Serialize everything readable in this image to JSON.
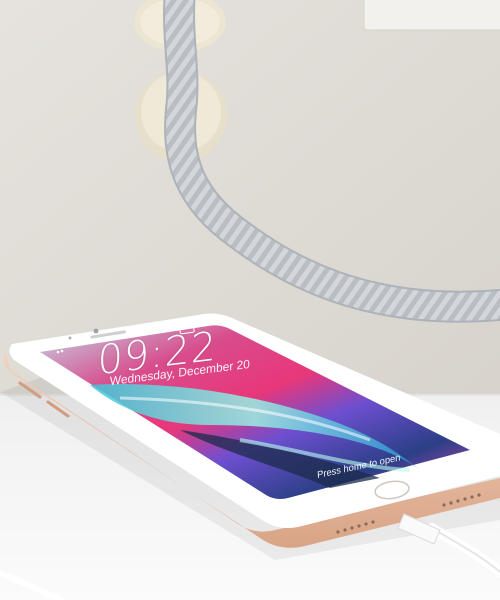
{
  "lock_screen": {
    "time": "09:22",
    "date": "Wednesday, December 20",
    "unlock_hint": "Press home to open"
  },
  "colors": {
    "wall": "#dedad4",
    "desk": "#f4f4f4",
    "phone_body": "#e9bfa5",
    "phone_front": "#ffffff",
    "cable": "#cfd3d8",
    "cable_clip": "#ece7d6"
  }
}
